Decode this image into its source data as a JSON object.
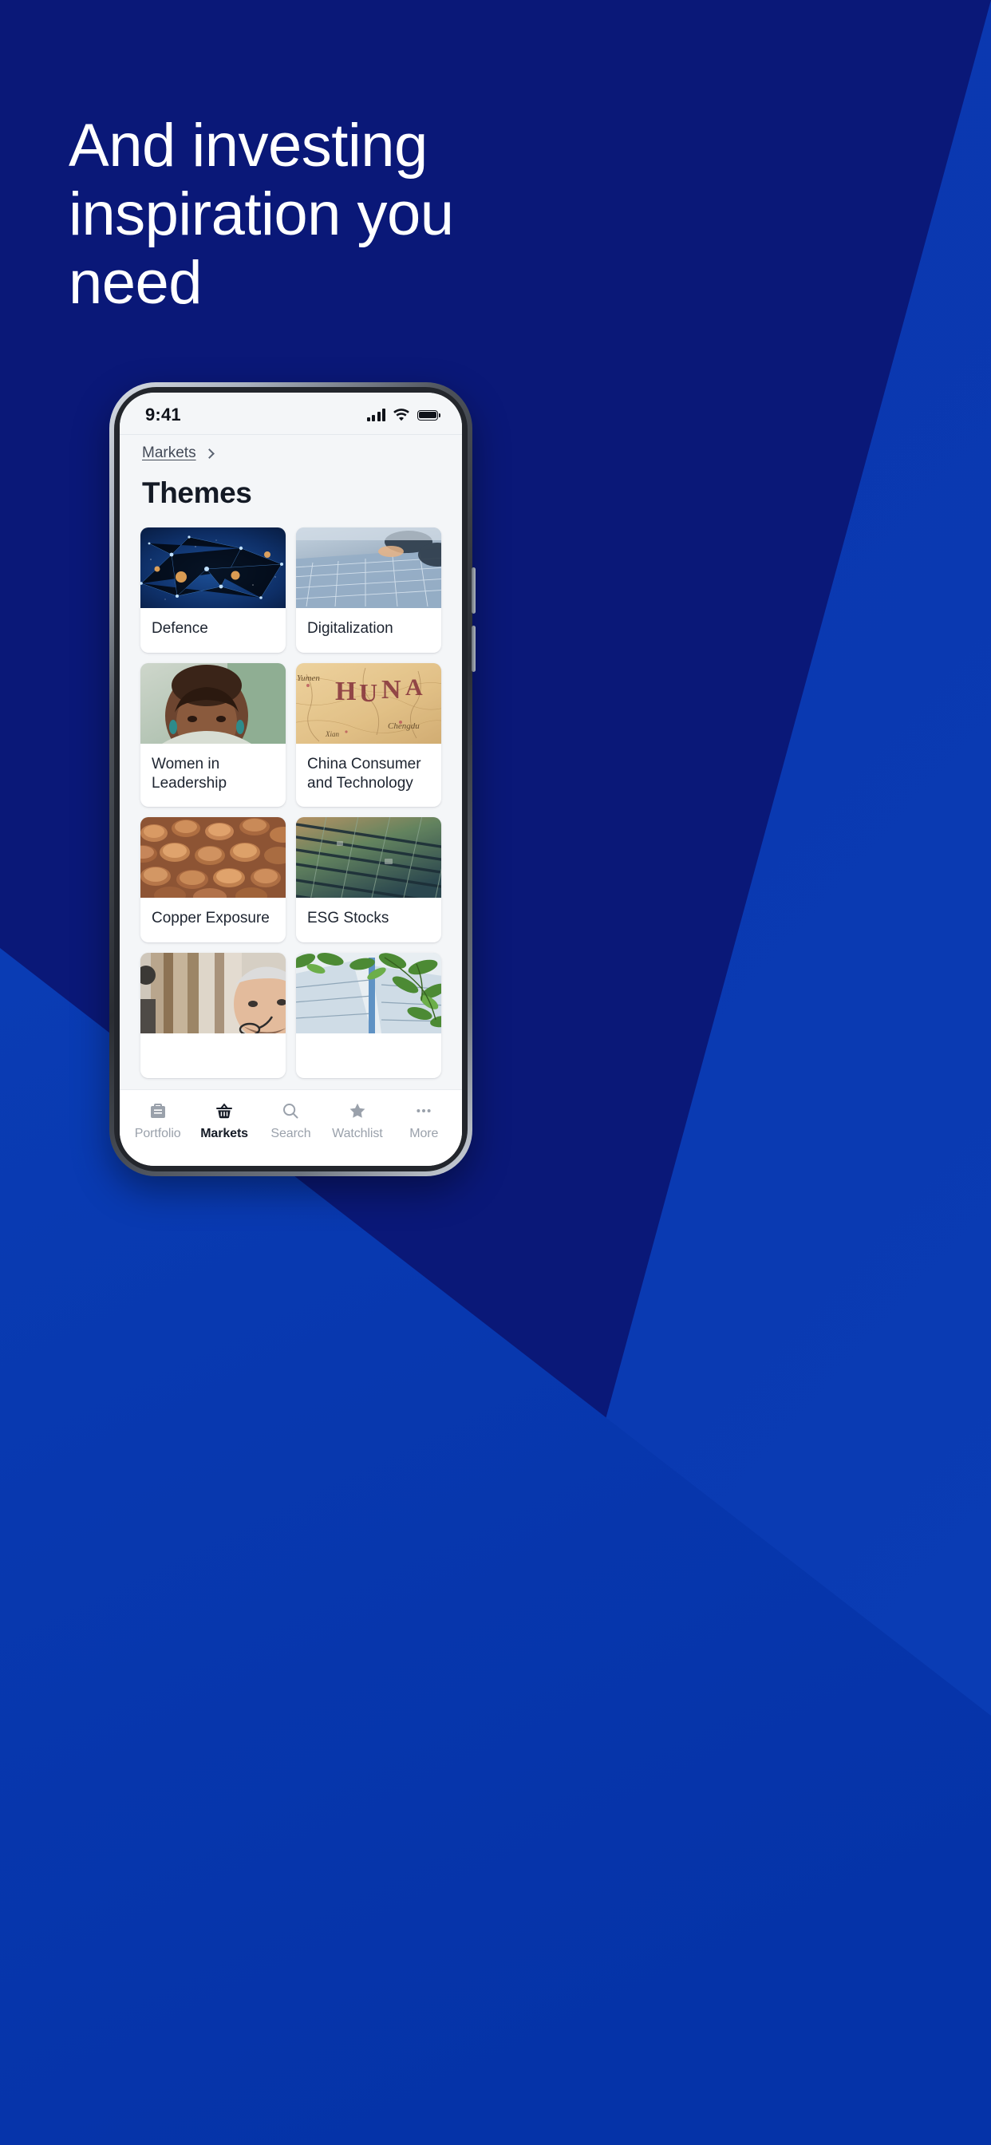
{
  "colors": {
    "bg_navy": "#0a1878",
    "bg_blue": "#0a3cb4",
    "bg_blue_dark": "#062a8e",
    "text_white": "#ffffff",
    "screen_bg": "#f4f6f8",
    "card_bg": "#ffffff",
    "title_text": "#141a25",
    "muted_text": "#9aa1ab"
  },
  "headline": "And investing\ninspiration you\nneed",
  "phone": {
    "status_bar": {
      "time": "9:41",
      "icons": [
        "cellular-signal-icon",
        "wifi-icon",
        "battery-icon"
      ]
    },
    "header": {
      "breadcrumb_label": "Markets",
      "breadcrumb_chevron": "chevron-right-icon",
      "page_title": "Themes"
    },
    "themes": [
      {
        "label": "Defence",
        "image": "network-globe-night"
      },
      {
        "label": "Digitalization",
        "image": "laptop-keyboard-hands"
      },
      {
        "label": "Women in\nLeadership",
        "image": "portrait-woman-smiling"
      },
      {
        "label": "China Consumer\nand Technology",
        "image": "vintage-map-china"
      },
      {
        "label": "Copper Exposure",
        "image": "copper-coins-pile"
      },
      {
        "label": "ESG Stocks",
        "image": "solar-panel-array"
      },
      {
        "label": "",
        "image": "man-with-glasses-office"
      },
      {
        "label": "",
        "image": "green-leaves-building"
      }
    ],
    "tabbar": [
      {
        "label": "Portfolio",
        "icon": "briefcase-icon",
        "active": false
      },
      {
        "label": "Markets",
        "icon": "basket-icon",
        "active": true
      },
      {
        "label": "Search",
        "icon": "search-icon",
        "active": false
      },
      {
        "label": "Watchlist",
        "icon": "star-icon",
        "active": false
      },
      {
        "label": "More",
        "icon": "ellipsis-icon",
        "active": false
      }
    ]
  }
}
